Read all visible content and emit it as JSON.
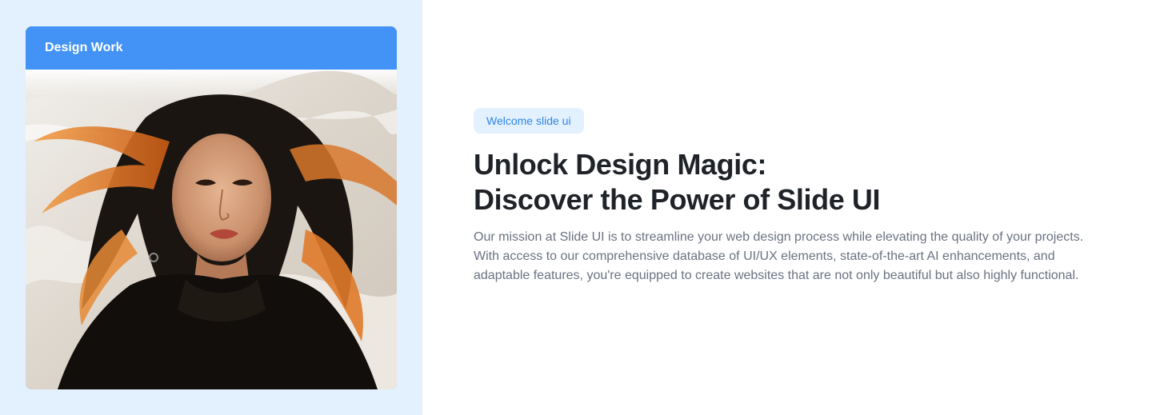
{
  "card": {
    "title": "Design Work",
    "image": "portrait-woman-flowing-hair"
  },
  "hero": {
    "badge": "Welcome slide ui",
    "headline_line1": "Unlock Design Magic:",
    "headline_line2": "Discover the Power of Slide UI",
    "description": "Our mission at Slide UI is to streamline your web design process while elevating the quality of your projects. With access to our comprehensive database of UI/UX elements, state-of-the-art AI enhancements, and adaptable features, you're equipped to create websites that are not only beautiful but also highly functional."
  },
  "colors": {
    "accent": "#4293f5",
    "panel_bg": "#e3f0fd",
    "badge_text": "#2f86e8",
    "heading": "#1f2328",
    "body_text": "#6b7280"
  }
}
